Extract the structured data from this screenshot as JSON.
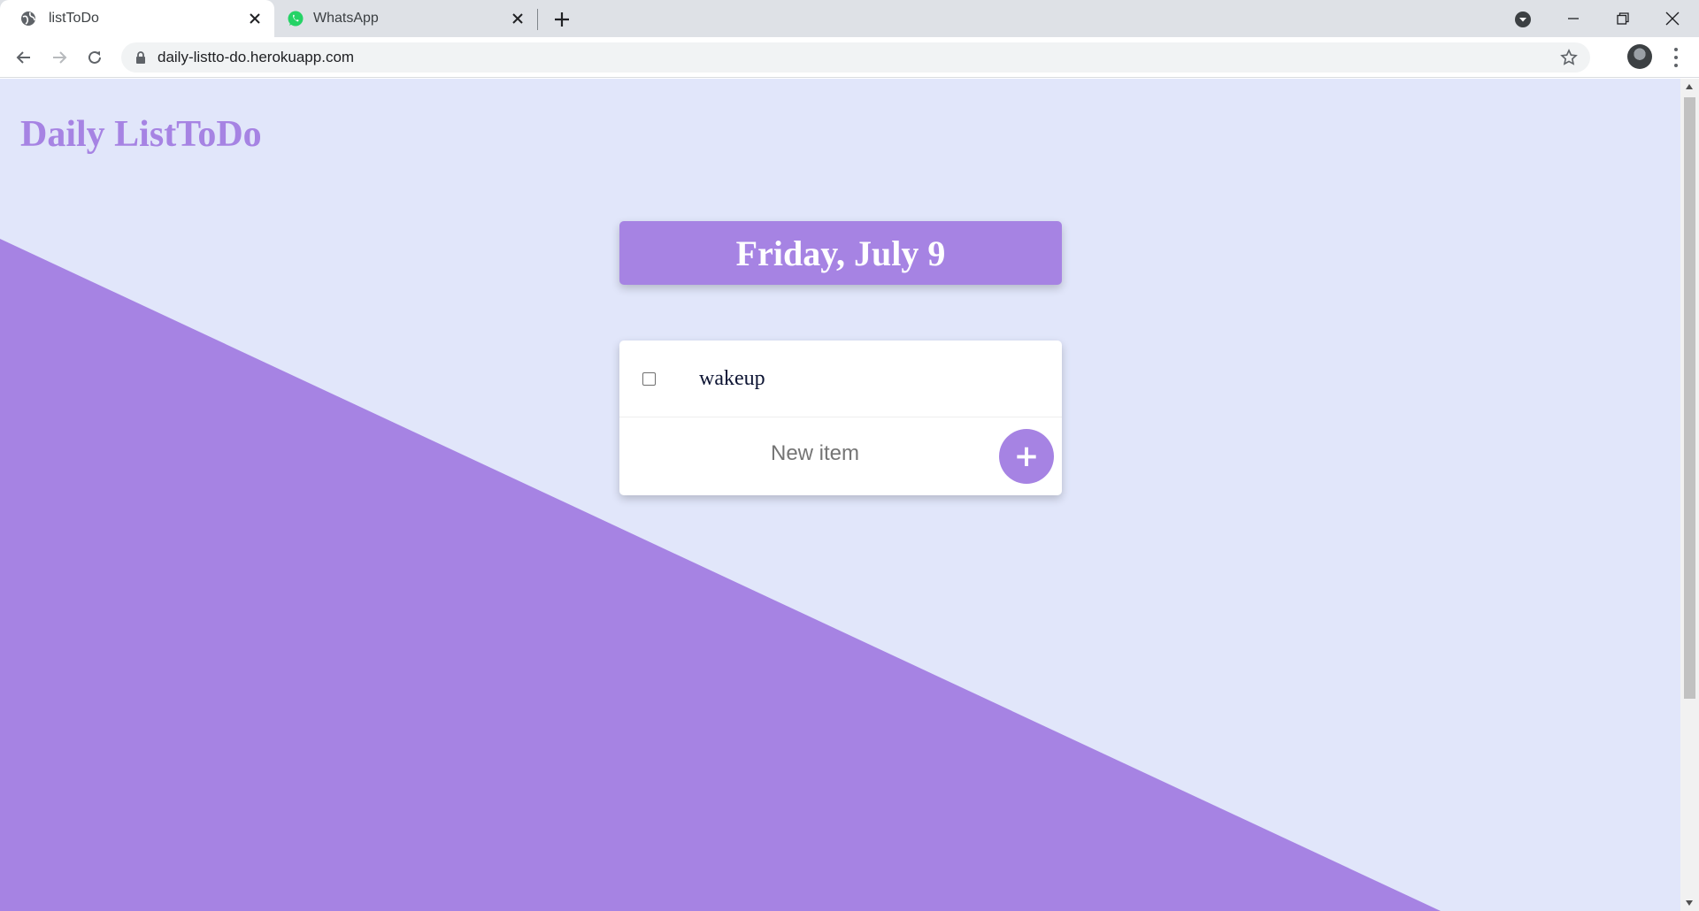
{
  "browser": {
    "tabs": [
      {
        "title": "listToDo",
        "favicon": "globe-icon",
        "active": true
      },
      {
        "title": "WhatsApp",
        "favicon": "whatsapp-icon",
        "active": false
      }
    ],
    "url": "daily-listto-do.herokuapp.com"
  },
  "app": {
    "brand": "Daily ListToDo",
    "date_heading": "Friday, July 9",
    "items": [
      {
        "text": "wakeup",
        "checked": false
      }
    ],
    "new_item_placeholder": "New item",
    "add_button_label": "+"
  },
  "colors": {
    "accent": "#a683e3",
    "background": "#e1e6fa",
    "card": "#ffffff"
  }
}
